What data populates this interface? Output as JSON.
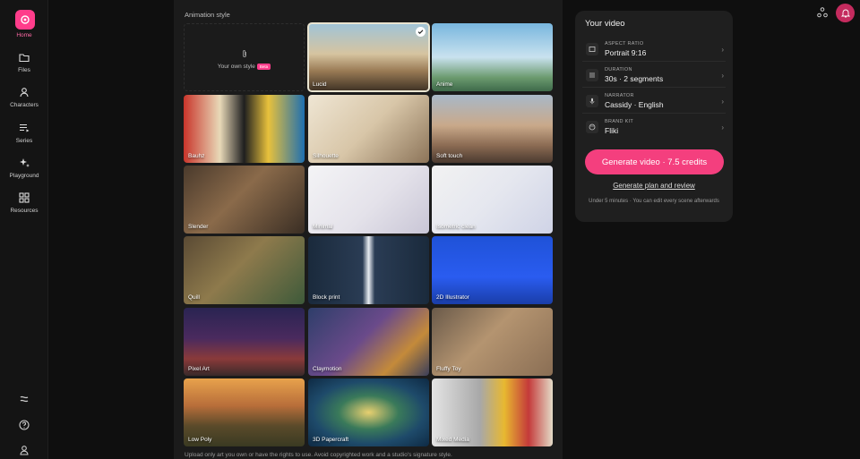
{
  "sidebar": {
    "items": [
      {
        "label": "Home",
        "icon": "home-icon"
      },
      {
        "label": "Files",
        "icon": "folder-icon"
      },
      {
        "label": "Characters",
        "icon": "person-icon"
      },
      {
        "label": "Series",
        "icon": "playlist-icon"
      },
      {
        "label": "Playground",
        "icon": "sparkle-icon"
      },
      {
        "label": "Resources",
        "icon": "grid-icon"
      }
    ]
  },
  "main": {
    "section_title": "Animation style",
    "own_style": {
      "label": "Your own style",
      "badge": "Beta"
    },
    "styles": [
      {
        "label": "Lucid",
        "selected": true
      },
      {
        "label": "Anime"
      },
      {
        "label": "Bauhz"
      },
      {
        "label": "Silhouette"
      },
      {
        "label": "Soft touch"
      },
      {
        "label": "Slender"
      },
      {
        "label": "Minimal"
      },
      {
        "label": "Isometric clean"
      },
      {
        "label": "Quill"
      },
      {
        "label": "Block print"
      },
      {
        "label": "2D Illustrator"
      },
      {
        "label": "Pixel Art"
      },
      {
        "label": "Claymotion"
      },
      {
        "label": "Fluffy Toy"
      },
      {
        "label": "Low Poly"
      },
      {
        "label": "3D Papercraft"
      },
      {
        "label": "Mixed Media"
      }
    ],
    "footer_note": "Upload only art you own or have the rights to use. Avoid copyrighted work and a studio's signature style."
  },
  "panel": {
    "title": "Your video",
    "rows": [
      {
        "label": "ASPECT RATIO",
        "value": "Portrait 9:16",
        "icon": "aspect-ratio-icon"
      },
      {
        "label": "DURATION",
        "value": "30s · 2 segments",
        "icon": "duration-icon"
      },
      {
        "label": "NARRATOR",
        "value": "Cassidy · English",
        "icon": "microphone-icon"
      },
      {
        "label": "BRAND KIT",
        "value": "Fliki",
        "icon": "palette-icon"
      }
    ],
    "generate_button": "Generate video · 7.5 credits",
    "plan_link": "Generate plan and review",
    "note": "Under 5 minutes · You can edit every scene afterwards"
  },
  "colors": {
    "accent": "#f43f7e",
    "brand": "#ff3d8b"
  }
}
